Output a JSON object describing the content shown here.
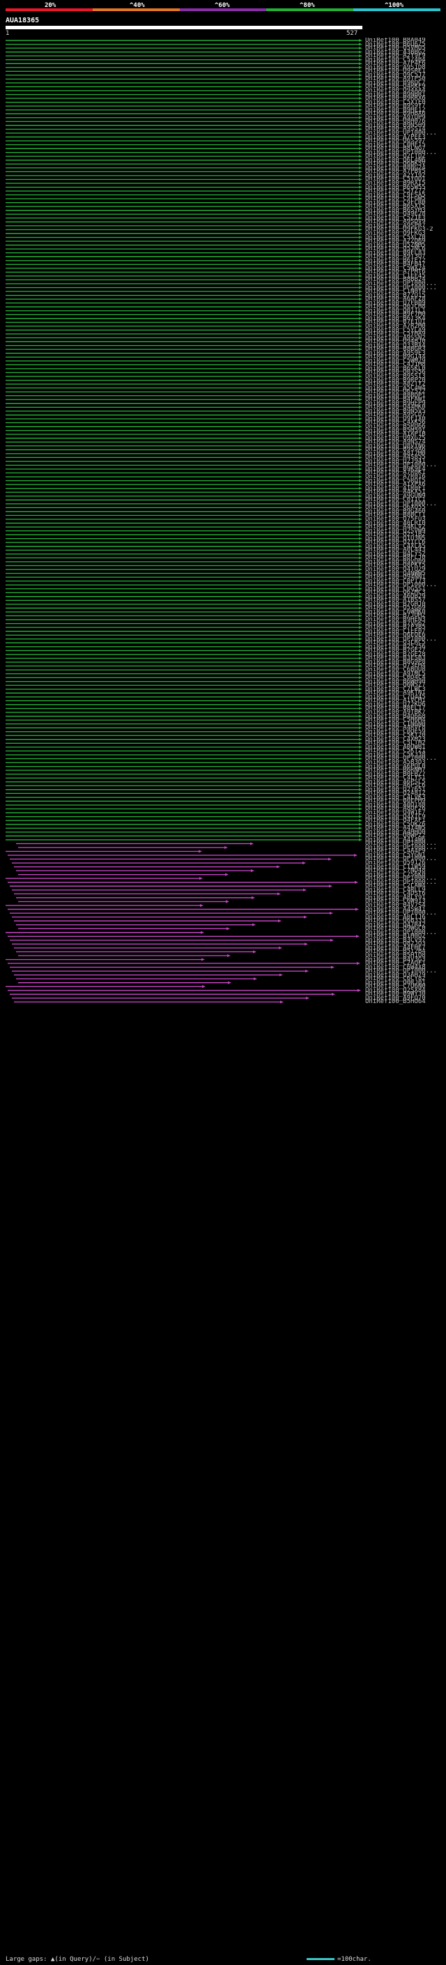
{
  "scale": {
    "ticks": [
      "20%",
      "^40%",
      "^60%",
      "^80%",
      "^100%"
    ],
    "colors": [
      "#e8182a",
      "#e07722",
      "#8a2ea8",
      "#22b036",
      "#2cc4cc"
    ]
  },
  "query": {
    "title": "AUA18365",
    "start": "1",
    "end": "527",
    "length": 527
  },
  "legend": {
    "text": "Large gaps: ▲(in Query)/− (in Subject)",
    "scale_text": "=100char."
  },
  "chart_data": {
    "type": "alignment",
    "x_range": [
      1,
      527
    ],
    "series": [
      {
        "color": "#22b036",
        "hits": 208
      },
      {
        "color": "#c445c4",
        "hits": 50
      },
      {
        "color": "#22b036",
        "hits": 3
      },
      {
        "color": "#c445c4",
        "hits": 5
      }
    ],
    "hits": [
      "UniRef100_B8A049",
      "UniRef100_B6U6Z5",
      "UniRef100_Q5VMU5",
      "UniRef100_A3BBG2",
      "UniRef100_A2Y9F9",
      "UniRef100_C5Z4B4",
      "UniRef100_A7P4F6",
      "UniRef100_A9S1D8",
      "UniRef100_Q9SRE1",
      "UniRef100_Q9C5J7",
      "UniRef100_A9TPS0",
      "UniRef100_B9RQC7",
      "UniRef100_Q4RKF9",
      "UniRef100_Q94AA4",
      "UniRef100_B9NBR1",
      "UniRef100_B9RRX6",
      "UniRef100_C5XTE0",
      "UniRef100_B9S9Y7",
      "UniRef100_B9HE12",
      "UniRef100_B9HBX6",
      "UniRef100_A9TUP9",
      "UniRef100_Q8H076",
      "UniRef100_B9N5H9",
      "UniRef100_A9SS14",
      "UniRef100_UP1000...",
      "UniRef100_A7PEE3",
      "UniRef100_Q6S597",
      "UniRef100_C0HF15",
      "UniRef100_B8LNG7",
      "UniRef100_UP1000...",
      "UniRef100_Q2LTU2",
      "UniRef100_Q6L4N6",
      "UniRef100_Q6BK5V",
      "UniRef100_B8BG24",
      "UniRef100_A7PBV5",
      "UniRef100_A2Y192",
      "UniRef100_C5YUD1",
      "UniRef100_B9RXI5",
      "UniRef100_B6SW55",
      "UniRef100_C5YZ72",
      "UniRef100_C9FSA5",
      "UniRef100_C9FGW5",
      "UniRef100_C9FCR0",
      "UniRef100_B6SXT5",
      "UniRef100_B6SYM3",
      "UniRef100_Q49E28",
      "UniRef100_C5Z1E3",
      "UniRef100_A9SDV9",
      "UniRef100_A9SPR7",
      "UniRef100_Q9FKG3-2",
      "UniRef100_Q9FKG3",
      "UniRef100_C5XLZ0",
      "UniRef100_A2ZQ69",
      "UniRef100_Q5ZNM5",
      "UniRef100_Q5JNC6",
      "UniRef100_B9FL83",
      "UniRef100_A9T3U7",
      "UniRef100_B6TE72",
      "UniRef100_B4FB47",
      "UniRef100_C5WX24",
      "UniRef100_A7PMT6",
      "UniRef100_C1EF45",
      "UniRef100_B8BB24",
      "UniRef100_UP1000...",
      "UniRef100_UP1000...",
      "UniRef100_C1N0Y4",
      "UniRef100_B7ZU15",
      "UniRef100_A6AFZ8",
      "UniRef100_Q7FB09",
      "UniRef100_Q0JCH8",
      "UniRef100_Q01IL1",
      "UniRef100_B9F7M0",
      "UniRef100_B6T3K4",
      "UniRef100_B7E1U1",
      "UniRef100_A7R2M0",
      "UniRef100_C5YLA9",
      "UniRef100_C5YHA9",
      "UniRef100_A9SSN2",
      "UniRef100_Q94BJ0",
      "UniRef100_Q33BX4",
      "UniRef100_B8BGR3",
      "UniRef100_A9S9E3",
      "UniRef100_B9G144",
      "UniRef100_C5WM79",
      "UniRef100_C4J1M8",
      "UniRef100_B6SKL0",
      "UniRef100_Q0JS56",
      "UniRef100_B9SSI3",
      "UniRef100_B9RPZ0",
      "UniRef100_A8ZTY2",
      "UniRef100_A5C4W4",
      "UniRef100_Q6Z522",
      "UniRef100_B8BDP1",
      "UniRef100_B4FAW1",
      "UniRef100_B9HFP9",
      "UniRef100_Q44MK0",
      "UniRef100_B9N5V5",
      "UniRef100_A9SCD7",
      "UniRef100_Q9FIX0",
      "UniRef100_C4XK56",
      "UniRef100_B5RQ66",
      "UniRef100_B5M59I",
      "UniRef100_A1AP1B",
      "UniRef100_Q9XGZ5",
      "UniRef100_A9NS74",
      "UniRef100_Q8VYN6",
      "UniRef100_B9S9A6",
      "UniRef100_A8I7M0",
      "UniRef100_A4S855",
      "UniRef100_Q2J941",
      "UniRef100_UP1000...",
      "UniRef100_B9K9E4",
      "UniRef100_A7R0K1",
      "UniRef100_A7R016",
      "UniRef100_C5RQT5",
      "UniRef100_A1XPX6",
      "UniRef100_A1R0F1",
      "UniRef100_A4KX51",
      "UniRef100_A9GUN9",
      "UniRef100_C0IIC1",
      "UniRef100_UP1000...",
      "UniRef100_Q6XQ55",
      "UniRef100_B9G460",
      "UniRef100_B8BCT1",
      "UniRef100_Q75FU3",
      "UniRef100_A0LRI0",
      "UniRef100_A4KLV2",
      "UniRef100_Q2SVW9",
      "UniRef100_Q2S1B2",
      "UniRef100_Q1U3N5",
      "UniRef100_Q2ILL6",
      "UniRef100_C4XLA5",
      "UniRef100_A0L443",
      "UniRef100_B4CY52",
      "UniRef100_B8FLJ0",
      "UniRef100_B9VU09",
      "UniRef100_Q8PKY5",
      "UniRef100_Q4TQ29",
      "UniRef100_Q4NWW5",
      "UniRef100_Q94NN1",
      "UniRef100_C0PT73",
      "UniRef100_UP1000...",
      "UniRef100_C0G5S1",
      "UniRef100_Q6ZMC3",
      "UniRef100_A6DB29",
      "UniRef100_A1BS57",
      "UniRef100_B7GHJ0",
      "UniRef100_Q51G69",
      "UniRef100_C6WMK0",
      "UniRef100_B7JOM2",
      "UniRef100_B9HEN3",
      "UniRef100_B7VG62",
      "UniRef100_B7P3B5",
      "UniRef100_C1EE07",
      "UniRef100_Q6EQE6",
      "UniRef100_UP1000...",
      "UniRef100_Q3LRC5",
      "UniRef100_B2S256",
      "UniRef100_B7GE27",
      "UniRef100_B7GE28",
      "UniRef100_B3ESB3",
      "UniRef100_B8G9P8",
      "UniRef100_Q73EM4",
      "UniRef100_C6BUU8",
      "UniRef100_A9TML5",
      "UniRef100_C0D4C4",
      "UniRef100_B6WH90",
      "UniRef100_Q6W5Z7",
      "UniRef100_C7LWC3",
      "UniRef100_A9KTN1",
      "UniRef100_C7Q445",
      "UniRef100_A1VCM1",
      "UniRef100_Q72KD6",
      "UniRef100_B8EL17",
      "UniRef100_A9TBK7",
      "UniRef100_B4D668",
      "UniRef100_C5H6M4",
      "UniRef100_C1N6N0",
      "UniRef100_A4RVF8",
      "UniRef100_C0QE59",
      "UniRef100_C5KT20",
      "UniRef100_C4XM23",
      "UniRef100_C5LTH2",
      "UniRef100_A0UWB1",
      "UniRef100_C5KT21",
      "UniRef100_C5K338",
      "UniRef100_UP1000...",
      "UniRef100_A5B3D3",
      "UniRef100_A6PUL0",
      "UniRef100_B6RNM7",
      "UniRef100_B0EBZ7",
      "UniRef100_C4LYS1",
      "UniRef100_A6PSL5",
      "UniRef100_A6PSL6",
      "UniRef100_Q27651",
      "UniRef100_Q24812",
      "UniRef100_C4LVK3",
      "UniRef100_B0EPM9",
      "UniRef100_A0DI88",
      "UniRef100_A8UF26",
      "UniRef100_Q4W1E7",
      "UniRef100_Q4XIC9",
      "UniRef100_Q4FXF1",
      "UniRef100_C5QKZ6",
      "UniRef100_A4I4W5",
      "UniRef100_A4HHD0",
      "UniRef100_Q8WPZ2",
      "UniRef100_A4I4W6",
      "UniRef100_UP1000...",
      "UniRef100_UP1000...",
      "UniRef100_C4A4P9",
      "UniRef100_C5YGN1",
      "UniRef100_UP1000...",
      "UniRef100_Q59126",
      "UniRef100_C11W59",
      "UniRef100_C7ND48",
      "UniRef100_C7S6K0",
      "UniRef100_UP1000...",
      "UniRef100_UP1000...",
      "UniRef100_C2LAW4",
      "UniRef100_C4RLL9",
      "UniRef100_C4DST6",
      "UniRef100_A8LY91",
      "UniRef100_C6W913",
      "UniRef100_B4V7S4",
      "UniRef100_A4SW41",
      "UniRef100_UP1000...",
      "UniRef100_A0LTJ6",
      "UniRef100_Q6B333",
      "UniRef100_Q47R42",
      "UniRef100_Q9WGC0",
      "UniRef100_UP1000...",
      "UniRef100_B1H0U2",
      "UniRef100_B3CV97",
      "UniRef100_Q82JQ3",
      "UniRef100_A4FHE7",
      "UniRef100_B5I2B4",
      "UniRef100_B5H1Q8",
      "UniRef100_B4V3G3",
      "UniRef100_C2AQF1",
      "UniRef100_C6W4X8",
      "UniRef100_UP1000...",
      "UniRef100_Q3AH79",
      "UniRef100_C6CY82",
      "UniRef100_Q0RJ01",
      "UniRef100_C7Q6N0",
      "UniRef100_Q2SX84",
      "UniRef100_B9WY30",
      "UniRef100_A9FQ70",
      "UniRef100_B5HU64"
    ]
  }
}
